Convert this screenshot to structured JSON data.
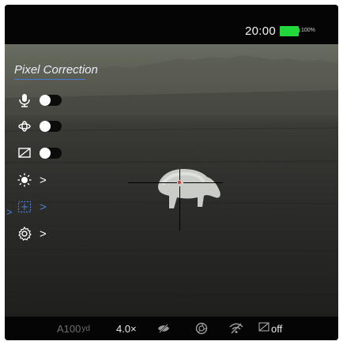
{
  "status_bar": {
    "time": "20:00",
    "battery_percent_label": "100%",
    "battery_level": 1.0,
    "battery_color": "#21d93b"
  },
  "menu": {
    "title": "Pixel Correction",
    "accent_color": "#4b7bd8",
    "items": [
      {
        "icon": "microphone-icon",
        "control": "toggle",
        "state": "on"
      },
      {
        "icon": "motion-sensor-icon",
        "control": "toggle",
        "state": "on"
      },
      {
        "icon": "display-off-icon",
        "control": "toggle",
        "state": "on"
      },
      {
        "icon": "brightness-icon",
        "control": "submenu"
      },
      {
        "icon": "pixel-correction-icon",
        "control": "submenu",
        "selected": true
      },
      {
        "icon": "settings-gear-icon",
        "control": "submenu"
      }
    ],
    "chevron": ">",
    "selection_marker": ">"
  },
  "bottom_bar": {
    "distance_prefix": "A",
    "distance_value": "100",
    "distance_unit": "yd",
    "zoom": "4.0×",
    "icons": [
      "hidden-eye-icon",
      "aperture-icon",
      "wifi-off-icon",
      "display-off-icon"
    ],
    "display_off_state": "off"
  },
  "reticle": {
    "center_dot_color": "#d23b3b"
  }
}
